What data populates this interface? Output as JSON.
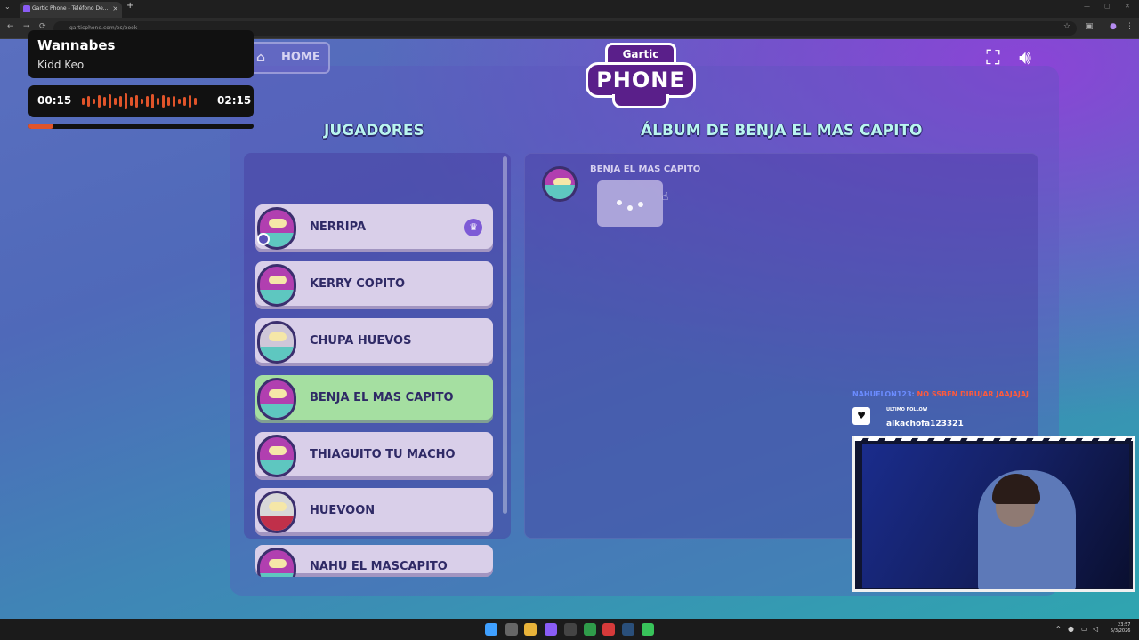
{
  "browser": {
    "tab_title": "Gartic Phone - Teléfono De...",
    "url": "garticphone.com/es/book"
  },
  "page": {
    "home_label": "HOME",
    "logo_top": "Gartic",
    "logo_main": "PHONE",
    "players_heading": "JUGADORES",
    "album_heading": "ÁLBUM DE BENJA EL MAS CAPITO",
    "players": [
      {
        "name": "NERRIPA",
        "host": true,
        "active": false,
        "avatar": "bird-avatar"
      },
      {
        "name": "KERRY COPITO",
        "host": false,
        "active": false,
        "avatar": "bird-avatar"
      },
      {
        "name": "CHUPA HUEVOS",
        "host": false,
        "active": false,
        "avatar": "goggles-avatar"
      },
      {
        "name": "BENJA EL MAS CAPITO",
        "host": false,
        "active": true,
        "avatar": "bird-avatar"
      },
      {
        "name": "THIAGUITO TU MACHO",
        "host": false,
        "active": false,
        "avatar": "bird-avatar"
      },
      {
        "name": "HUEVOON",
        "host": false,
        "active": false,
        "avatar": "knight-avatar"
      },
      {
        "name": "NAHU EL MASCAPITO",
        "host": false,
        "active": false,
        "avatar": "bird-avatar"
      }
    ],
    "album_author": "BENJA EL MAS CAPITO"
  },
  "music_widget": {
    "song": "Wannabes",
    "artist": "Kidd Keo",
    "elapsed": "00:15",
    "total": "02:15",
    "progress": 0.11
  },
  "stream_overlay": {
    "chat_user": "NAHUELON123:",
    "chat_message": "NO SSBEN DIBUJAR JAAJAJAJ",
    "follow_label": "ULTIMO FOLLOW",
    "follow_name": "alkachofa123321"
  },
  "taskbar": {
    "time": "23:57",
    "date": "5/3/2026"
  },
  "colors": {
    "accent_heading": "#b9f5ef",
    "active_player": "#a5dfa1",
    "player_card": "#d9cfe9",
    "music_progress": "#e0542a"
  }
}
